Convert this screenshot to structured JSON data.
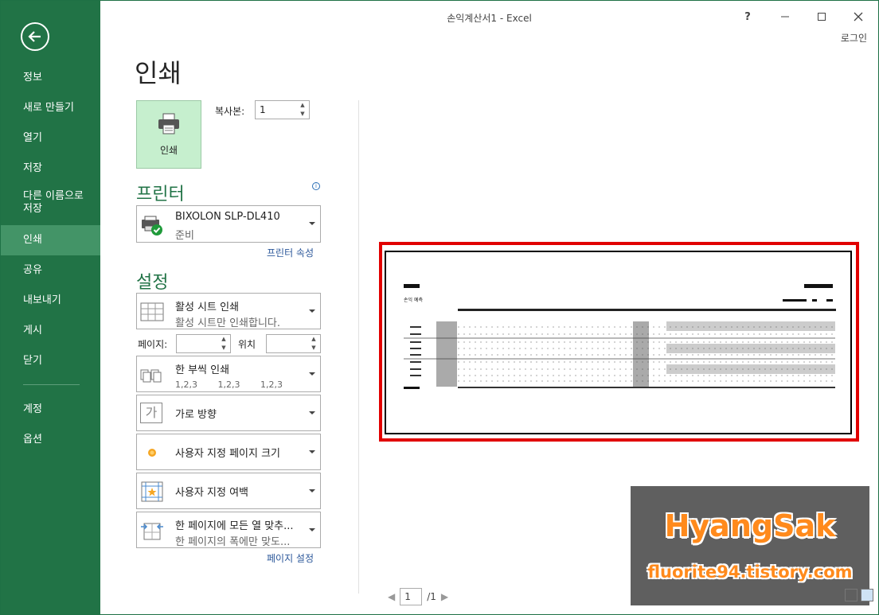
{
  "window": {
    "title": "손익계산서1 - Excel",
    "login": "로그인"
  },
  "sidebar": {
    "items": [
      {
        "label": "정보"
      },
      {
        "label": "새로 만들기"
      },
      {
        "label": "열기"
      },
      {
        "label": "저장"
      },
      {
        "label": "다른 이름으로 저장"
      },
      {
        "label": "인쇄",
        "active": true
      },
      {
        "label": "공유"
      },
      {
        "label": "내보내기"
      },
      {
        "label": "게시"
      },
      {
        "label": "닫기"
      },
      {
        "label": "계정"
      },
      {
        "label": "옵션"
      }
    ]
  },
  "print": {
    "page_title": "인쇄",
    "button_label": "인쇄",
    "copies_label": "복사본:",
    "copies_value": "1"
  },
  "printer": {
    "heading": "프린터",
    "name": "BIXOLON SLP-DL410",
    "status": "준비",
    "properties_link": "프린터 속성"
  },
  "settings": {
    "heading": "설정",
    "active_sheet": {
      "title": "활성 시트 인쇄",
      "subtitle": "활성 시트만 인쇄합니다."
    },
    "pages_label": "페이지:",
    "to_label": "위치",
    "collate": {
      "title": "한 부씩 인쇄",
      "seq": [
        "1,2,3",
        "1,2,3",
        "1,2,3"
      ]
    },
    "orientation": {
      "title": "가로 방향",
      "icon_char": "가"
    },
    "paper_size": {
      "title": "사용자 지정 페이지 크기"
    },
    "margins": {
      "title": "사용자 지정 여백"
    },
    "scaling": {
      "title": "한 페이지에 모든 열 맞추...",
      "subtitle": "한 페이지의 폭에만 맞도..."
    },
    "page_setup_link": "페이지 설정"
  },
  "preview": {
    "sheet_title": "손익 예측",
    "current_page": "1",
    "total_pages": "/1"
  },
  "watermark": {
    "line1": "HyangSak",
    "line2": "fluorite94.tistory.com"
  },
  "colors": {
    "accent": "#217346",
    "active_nav": "#439467",
    "highlight": "#e10000"
  }
}
